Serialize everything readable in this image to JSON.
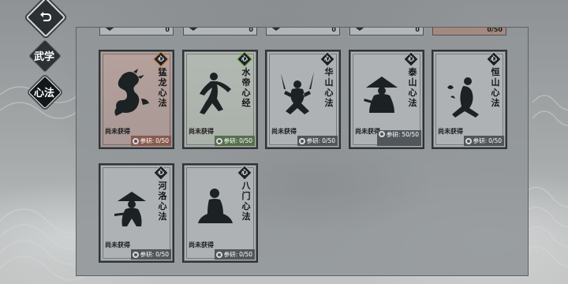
{
  "nav": {
    "back_icon": "return-arrow-icon",
    "tabs": [
      {
        "label": "武学",
        "active": false
      },
      {
        "label": "心法",
        "active": true
      }
    ]
  },
  "top_row": [
    {
      "value": "0"
    },
    {
      "value": "0"
    },
    {
      "value": "0"
    },
    {
      "value": "0"
    },
    {
      "value": "0/50"
    }
  ],
  "cards": [
    {
      "badge": "心",
      "name": "猛龙心法",
      "status": "尚未获得",
      "research_label": "参研:",
      "research_value": "0/50",
      "figure": "dragon-icon",
      "rarity_color": "#e28a3a"
    },
    {
      "badge": "心",
      "name": "水帝心经",
      "status": "尚未获得",
      "research_label": "参研:",
      "research_value": "0/50",
      "figure": "dancer-icon",
      "rarity_color": "#7fc25f"
    },
    {
      "badge": "心",
      "name": "华山心法",
      "status": "尚未获得",
      "research_label": "参研:",
      "research_value": "0/50",
      "figure": "swordsman-icon",
      "rarity_color": "#c8c9c9"
    },
    {
      "badge": "心",
      "name": "泰山心法",
      "status": "尚未获得",
      "research_label": "参研:",
      "research_value": "50/50",
      "figure": "hat-monk-icon",
      "rarity_color": "#c8c9c9"
    },
    {
      "badge": "心",
      "name": "恒山心法",
      "status": "尚未获得",
      "research_label": "参研:",
      "research_value": "0/50",
      "figure": "nun-icon",
      "rarity_color": "#c8c9c9"
    },
    {
      "badge": "心",
      "name": "河洛心法",
      "status": "尚未获得",
      "research_label": "参研:",
      "research_value": "0/50",
      "figure": "straw-hat-icon",
      "rarity_color": "#c8c9c9"
    },
    {
      "badge": "心",
      "name": "八门心法",
      "status": "尚未获得",
      "research_label": "参研:",
      "research_value": "0/50",
      "figure": "meditator-icon",
      "rarity_color": "#c8c9c9"
    }
  ]
}
